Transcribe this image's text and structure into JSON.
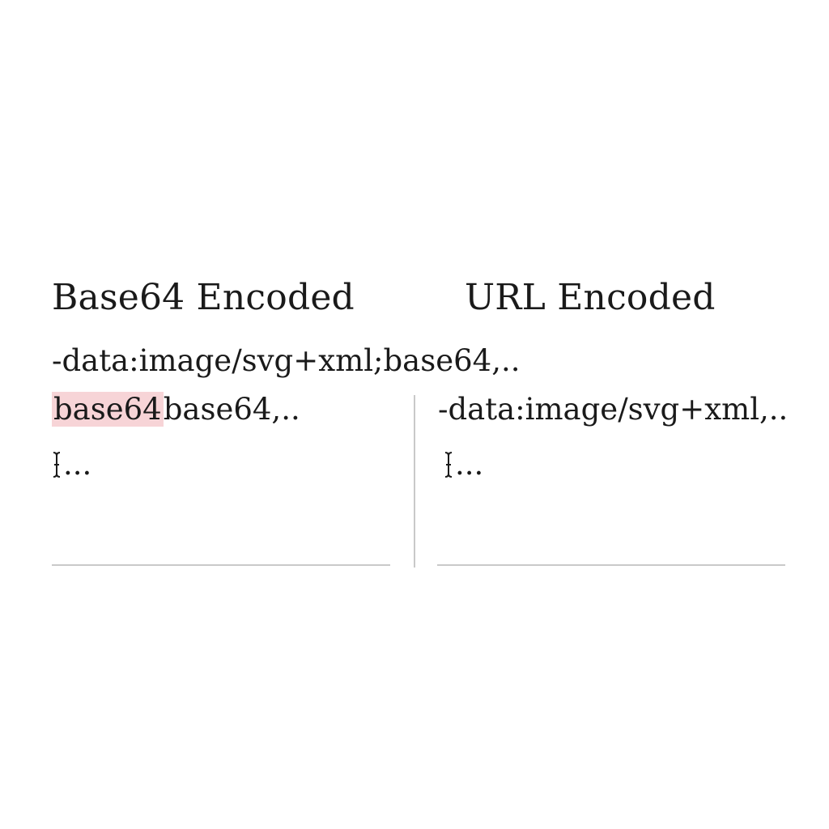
{
  "left_panel": {
    "heading": "Base64 Encoded",
    "line_top": "-data:image/svg+xml;base64,..",
    "highlight_text": "base64",
    "line_rest": "base64,..",
    "cursor_text": "..."
  },
  "right_panel": {
    "heading": "URL Encoded",
    "line": "-data:image/svg+xml,..",
    "cursor_text": "..."
  },
  "colors": {
    "highlight": "#f7d4d7",
    "rule": "#c9c9c9"
  },
  "icons": {
    "text_cursor": "text-cursor-icon"
  }
}
